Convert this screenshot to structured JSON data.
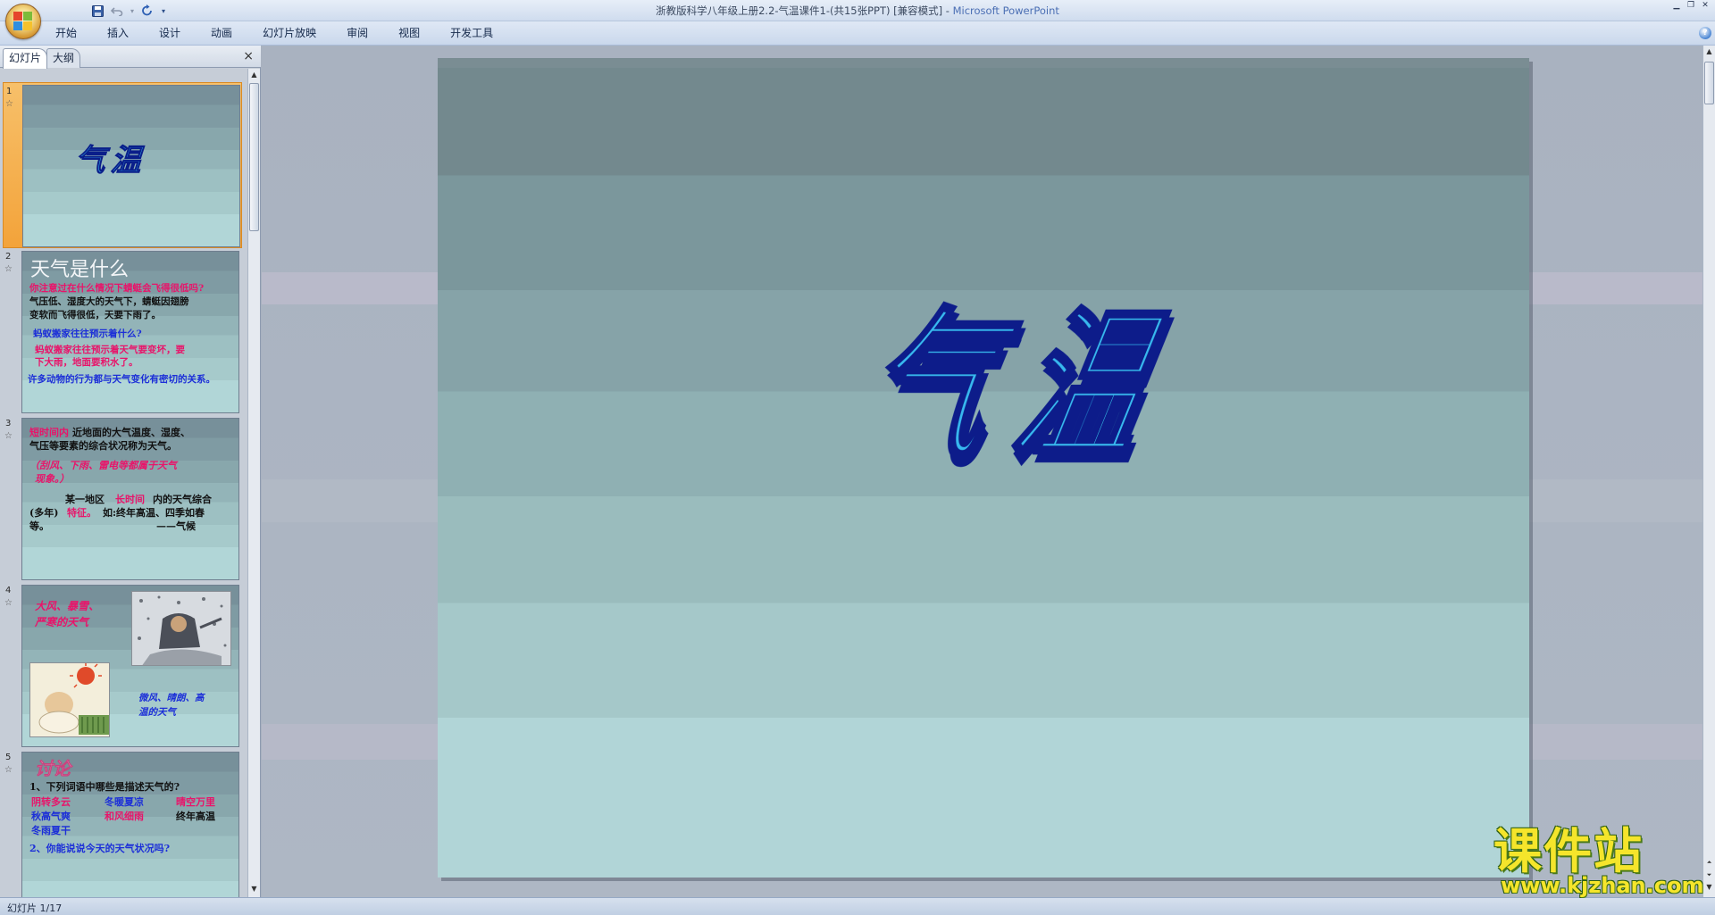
{
  "window": {
    "title": "浙教版科学八年级上册2.2-气温课件1-(共15张PPT) [兼容模式] - ",
    "app_name": "Microsoft PowerPoint"
  },
  "qat": {
    "save_icon": "save-icon",
    "undo_icon": "undo-icon",
    "redo_icon": "redo-icon",
    "customize_icon": "chevron-down-icon"
  },
  "ribbon": {
    "tabs": [
      "开始",
      "插入",
      "设计",
      "动画",
      "幻灯片放映",
      "审阅",
      "视图",
      "开发工具"
    ],
    "help": "?"
  },
  "left_pane": {
    "tab_slides": "幻灯片",
    "tab_outline": "大纲",
    "close": "×",
    "thumbnails": [
      {
        "number": "1",
        "title": "气温"
      },
      {
        "number": "2",
        "title": "天气是什么",
        "lines": [
          "你注意过在什么情况下蜻蜓会飞得很低吗?",
          "气压低、湿度大的天气下，蜻蜓因翅膀",
          "变软而飞得很低，天要下雨了。",
          "蚂蚁搬家往往预示着什么?",
          "蚂蚁搬家往往预示着天气要变坏，要",
          "下大雨，地面要积水了。",
          "许多动物的行为都与天气变化有密切的关系。"
        ]
      },
      {
        "number": "3",
        "lines": [
          "短时间内",
          "近地面的大气温度、湿度、",
          "气压等要素的综合状况称为天气。",
          "（刮风、下雨、雷电等都属于天气",
          "现象。）",
          "某一地区",
          "长时间",
          "内的天气综合",
          "(多年)",
          "特征。",
          "如:终年高温、四季如春",
          "等。",
          "——气候"
        ]
      },
      {
        "number": "4",
        "lines": [
          "大风、暴雪、",
          "严寒的天气",
          "微风、晴朗、高",
          "温的天气"
        ]
      },
      {
        "number": "5",
        "title": "讨论",
        "lines": [
          "1、下列词语中哪些是描述天气的?",
          "阴转多云",
          "冬暖夏凉",
          "晴空万里",
          "秋高气爽",
          "和风细雨",
          "终年高温",
          "冬雨夏干",
          "2、你能说说今天的天气状况吗?"
        ]
      }
    ]
  },
  "slide": {
    "title": "气温"
  },
  "status": {
    "text": "幻灯片 1/17"
  },
  "watermark": {
    "title": "课件站",
    "url": "www.kjzhan.com"
  },
  "colors": {
    "thumb_pink": "#e8146a",
    "thumb_blue": "#1c2fd8",
    "wordart_fill": "#38b8f0",
    "wordart_outline": "#0a1e8a",
    "selection_orange": "#f3a33a"
  }
}
